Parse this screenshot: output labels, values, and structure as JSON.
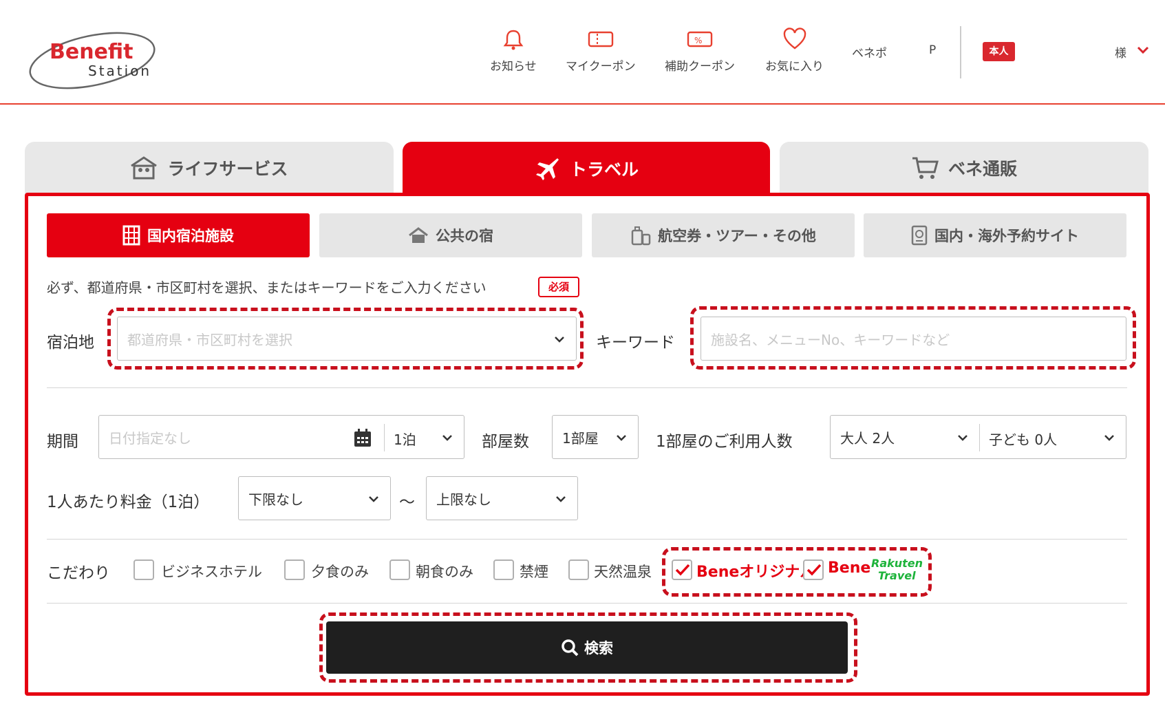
{
  "header": {
    "logo_line1": "Benefit",
    "logo_line2": "Station",
    "nav": [
      {
        "label": "お知らせ",
        "icon": "bell-icon"
      },
      {
        "label": "マイクーポン",
        "icon": "ticket-icon"
      },
      {
        "label": "補助クーポン",
        "icon": "percent-ticket-icon"
      },
      {
        "label": "お気に入り",
        "icon": "heart-icon"
      }
    ],
    "benepo_label": "ベネポ",
    "points_suffix": "P",
    "badge": "本人",
    "user_suffix": "様"
  },
  "main_tabs": [
    {
      "label": "ライフサービス",
      "icon": "house-people-icon"
    },
    {
      "label": "トラベル",
      "icon": "airplane-icon"
    },
    {
      "label": "ベネ通販",
      "icon": "cart-icon"
    }
  ],
  "sub_tabs": [
    {
      "label": "国内宿泊施設",
      "icon": "building-icon"
    },
    {
      "label": "公共の宿",
      "icon": "house-icon"
    },
    {
      "label": "航空券・ツアー・その他",
      "icon": "luggage-icon"
    },
    {
      "label": "国内・海外予約サイト",
      "icon": "passport-icon"
    }
  ],
  "form": {
    "note": "必ず、都道府県・市区町村を選択、またはキーワードをご入力ください",
    "required": "必須",
    "location_label": "宿泊地",
    "location_placeholder": "都道府県・市区町村を選択",
    "keyword_label": "キーワード",
    "keyword_placeholder": "施設名、メニューNo、キーワードなど",
    "period_label": "期間",
    "date_placeholder": "日付指定なし",
    "nights": "1泊",
    "rooms_label": "部屋数",
    "rooms": "1部屋",
    "guests_label": "1部屋のご利用人数",
    "adults": "大人 2人",
    "children": "子ども 0人",
    "price_label": "1人あたり料金（1泊）",
    "price_min": "下限なし",
    "tilde": "～",
    "price_max": "上限なし",
    "kodawari_label": "こだわり",
    "checkboxes": [
      {
        "label": "ビジネスホテル",
        "checked": false
      },
      {
        "label": "夕食のみ",
        "checked": false
      },
      {
        "label": "朝食のみ",
        "checked": false
      },
      {
        "label": "禁煙",
        "checked": false
      },
      {
        "label": "天然温泉",
        "checked": false
      }
    ],
    "bene_original": "Beneオリジナル",
    "bene_rakuten": "Bene",
    "rakuten_line1": "Rakuten",
    "rakuten_line2": "Travel",
    "search_button": "検索"
  },
  "colors": {
    "accent": "#e50011",
    "button": "#1f1f1f",
    "rakuten": "#1db33a"
  }
}
